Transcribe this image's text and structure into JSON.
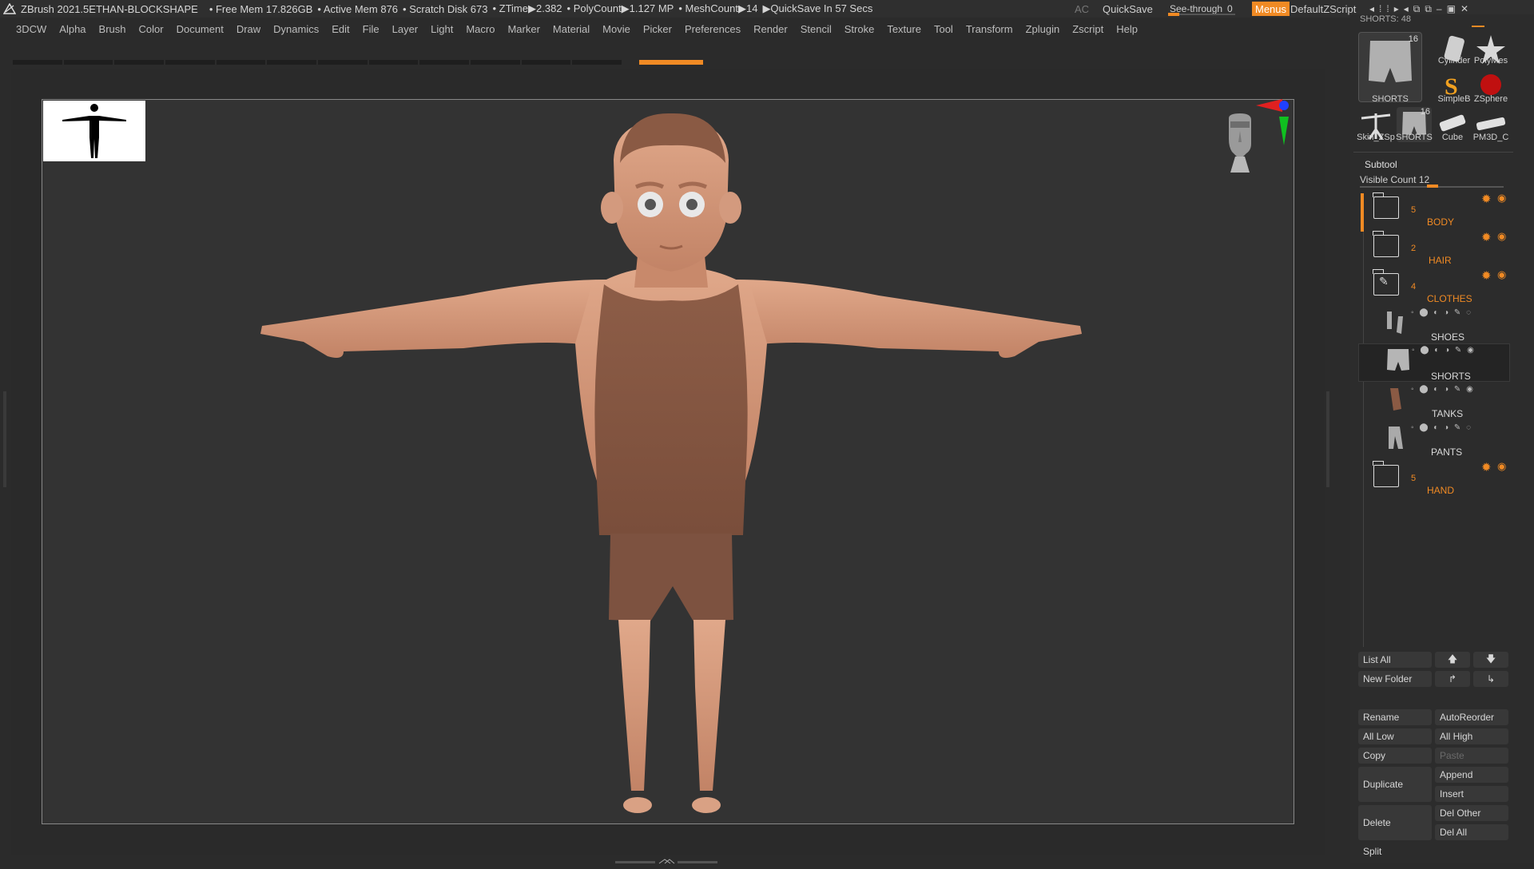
{
  "titlebar": {
    "app": "ZBrush 2021.5",
    "project": "ETHAN-BLOCKSHAPE",
    "free_mem": "• Free Mem 17.826GB",
    "active_mem": "• Active Mem 876",
    "scratch": "• Scratch Disk 673",
    "ztime": "• ZTime▶2.382",
    "polycount": "• PolyCount▶1.127 MP",
    "meshcount": "• MeshCount▶14",
    "quicksave_in": "▶QuickSave In 57 Secs",
    "ac": "AC",
    "quicksave": "QuickSave",
    "seethrough": "See-through",
    "seethrough_val": "0",
    "menus": "Menus",
    "script": "DefaultZScript"
  },
  "menubar": [
    "3DCW",
    "Alpha",
    "Brush",
    "Color",
    "Document",
    "Draw",
    "Dynamics",
    "Edit",
    "File",
    "Layer",
    "Light",
    "Macro",
    "Marker",
    "Material",
    "Movie",
    "Picker",
    "Preferences",
    "Render",
    "Stencil",
    "Stroke",
    "Texture",
    "Tool",
    "Transform",
    "Zplugin",
    "Zscript",
    "Help"
  ],
  "tools": {
    "header": "SHORTS: 48",
    "items": [
      {
        "label": "SHORTS",
        "badge": "16"
      },
      {
        "label": "Cylinder"
      },
      {
        "label": "PolyMes"
      },
      {
        "label": "SimpleB"
      },
      {
        "label": "ZSphere"
      },
      {
        "label": "Skin_ZSp"
      },
      {
        "label": "SHORTS",
        "badge": "16"
      },
      {
        "label": "Cube"
      },
      {
        "label": "PM3D_C"
      }
    ]
  },
  "subtool": {
    "title": "Subtool",
    "visible_count": "Visible Count 12",
    "rows": [
      {
        "num": "5",
        "name": "BODY"
      },
      {
        "num": "2",
        "name": "HAIR"
      },
      {
        "num": "4",
        "name": "CLOTHES"
      },
      {
        "name": "SHOES"
      },
      {
        "name": "SHORTS"
      },
      {
        "name": "TANKS"
      },
      {
        "name": "PANTS"
      },
      {
        "num": "5",
        "name": "HAND"
      }
    ]
  },
  "buttons": {
    "list_all": "List All",
    "new_folder": "New Folder",
    "rename": "Rename",
    "auto_reorder": "AutoReorder",
    "all_low": "All Low",
    "all_high": "All High",
    "copy": "Copy",
    "paste": "Paste",
    "duplicate": "Duplicate",
    "append": "Append",
    "insert": "Insert",
    "delete": "Delete",
    "del_other": "Del Other",
    "del_all": "Del All",
    "split": "Split"
  },
  "colors": {
    "accent": "#f08a24",
    "skin": "#d59a7a",
    "cloth": "#8a5a44"
  }
}
